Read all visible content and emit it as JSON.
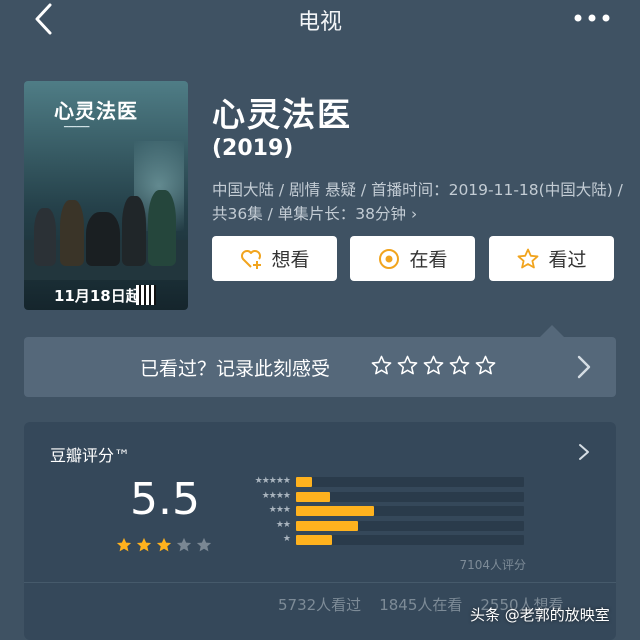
{
  "header": {
    "title": "电视"
  },
  "poster": {
    "title": "心灵法医",
    "date_text": "11月18日起"
  },
  "show": {
    "name": "心灵法医",
    "year": "(2019)",
    "meta": "中国大陆 / 剧情 悬疑 / 首播时间：2019-11-18(中国大陆) / 共36集 / 单集片长：38分钟 ›"
  },
  "actions": [
    {
      "label": "想看",
      "icon": "heart-plus-icon"
    },
    {
      "label": "在看",
      "icon": "target-icon"
    },
    {
      "label": "看过",
      "icon": "star-outline-icon"
    }
  ],
  "rating_prompt": {
    "text": "已看过？记录此刻感受",
    "star_count": 5
  },
  "douban_score": {
    "label": "豆瓣评分™",
    "value": "5.5",
    "stars_filled": 3,
    "distribution": [
      {
        "stars": "★★★★★",
        "fraction": 0.07
      },
      {
        "stars": "★★★★",
        "fraction": 0.15
      },
      {
        "stars": "★★★",
        "fraction": 0.34
      },
      {
        "stars": "★★",
        "fraction": 0.27
      },
      {
        "stars": "★",
        "fraction": 0.16
      }
    ],
    "rating_count": "7104人评分"
  },
  "stats": {
    "watched": "5732人看过",
    "watching": "1845人在看",
    "want": "2550人想看"
  },
  "watermark": "头条 @老郭的放映室",
  "colors": {
    "accent": "#ffb21e",
    "background": "#3f5263",
    "card": "#35485a"
  }
}
